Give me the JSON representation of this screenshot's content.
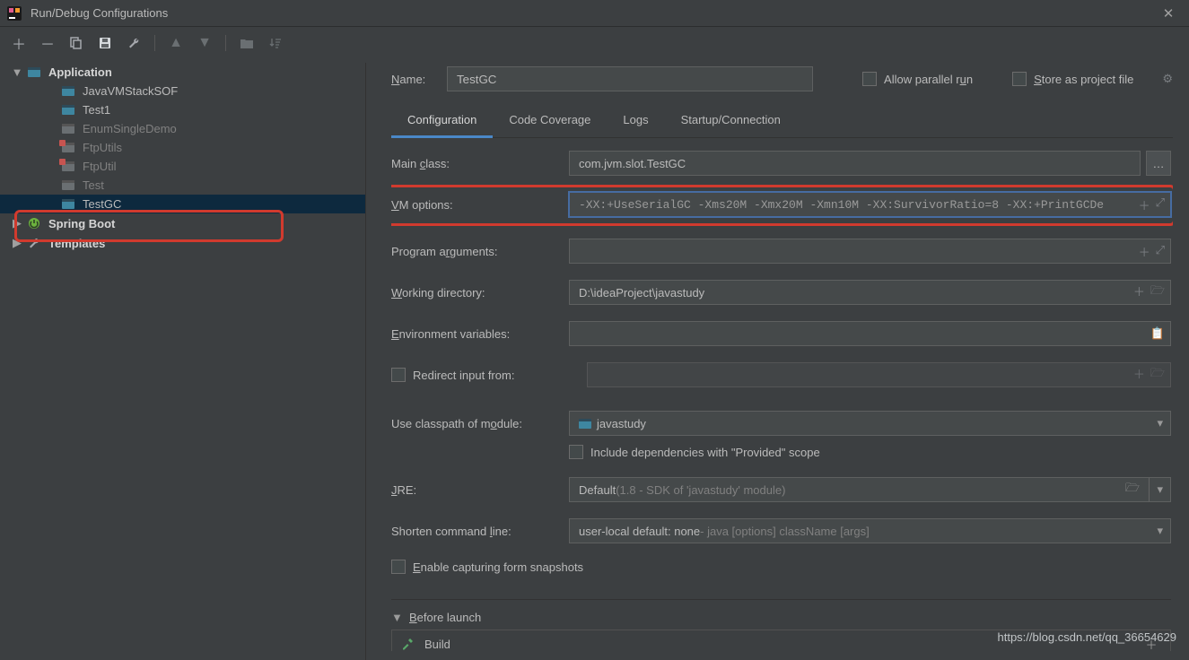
{
  "title": "Run/Debug Configurations",
  "tree": {
    "application_label": "Application",
    "items": [
      {
        "label": "JavaVMStackSOF",
        "dim": false
      },
      {
        "label": "Test1",
        "dim": false
      },
      {
        "label": "EnumSingleDemo",
        "dim": true
      },
      {
        "label": "FtpUtils",
        "dim": true,
        "err": true
      },
      {
        "label": "FtpUtil",
        "dim": true,
        "err": true
      },
      {
        "label": "Test",
        "dim": true
      },
      {
        "label": "TestGC",
        "dim": false,
        "selected": true
      }
    ],
    "spring_boot_label": "Spring Boot",
    "templates_label": "Templates"
  },
  "name": {
    "label": "Name:",
    "value": "TestGC"
  },
  "allow_parallel_label": "Allow parallel run",
  "store_project_label": "Store as project file",
  "tabs": [
    "Configuration",
    "Code Coverage",
    "Logs",
    "Startup/Connection"
  ],
  "form": {
    "main_class_label": "Main class:",
    "main_class_value": "com.jvm.slot.TestGC",
    "vm_label": "VM options:",
    "vm_value": "-XX:+UseSerialGC -Xms20M -Xmx20M -Xmn10M -XX:SurvivorRatio=8 -XX:+PrintGCDe",
    "prog_args_label": "Program arguments:",
    "prog_args_value": "",
    "workdir_label": "Working directory:",
    "workdir_value": "D:\\ideaProject\\javastudy",
    "env_label": "Environment variables:",
    "env_value": "",
    "redirect_label": "Redirect input from:",
    "module_label": "Use classpath of module:",
    "module_value": "javastudy",
    "include_provided_label": "Include dependencies with \"Provided\" scope",
    "jre_label": "JRE:",
    "jre_prefix": "Default ",
    "jre_suffix": "(1.8 - SDK of 'javastudy' module)",
    "shorten_label": "Shorten command line:",
    "shorten_prefix": "user-local default: none ",
    "shorten_suffix": "- java [options] className [args]",
    "enable_capture_label": "Enable capturing form snapshots",
    "before_launch_label": "Before launch",
    "build_label": "Build"
  },
  "watermark": "https://blog.csdn.net/qq_36654629"
}
